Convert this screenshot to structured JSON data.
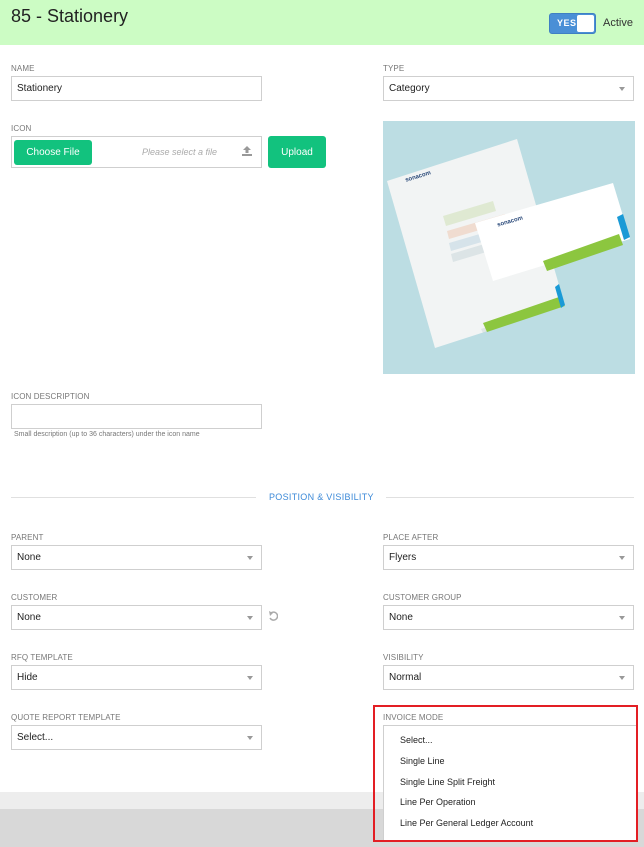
{
  "header": {
    "title": "85 - Stationery",
    "toggle_label": "YES",
    "status_label": "Active"
  },
  "form": {
    "name": {
      "label": "NAME",
      "value": "Stationery"
    },
    "type": {
      "label": "TYPE",
      "value": "Category"
    },
    "icon": {
      "label": "ICON",
      "choose_file": "Choose File",
      "placeholder": "Please select a file",
      "upload": "Upload"
    },
    "icon_description": {
      "label": "ICON DESCRIPTION",
      "value": "",
      "hint": "Small description (up to 36 characters) under the icon name"
    },
    "section_title": "POSITION & VISIBILITY",
    "parent": {
      "label": "PARENT",
      "value": "None"
    },
    "place_after": {
      "label": "PLACE AFTER",
      "value": "Flyers"
    },
    "customer": {
      "label": "CUSTOMER",
      "value": "None"
    },
    "customer_group": {
      "label": "CUSTOMER GROUP",
      "value": "None"
    },
    "rfq_template": {
      "label": "RFQ TEMPLATE",
      "value": "Hide"
    },
    "visibility": {
      "label": "VISIBILITY",
      "value": "Normal"
    },
    "quote_report_template": {
      "label": "QUOTE REPORT TEMPLATE",
      "value": "Select..."
    },
    "invoice_mode": {
      "label": "INVOICE MODE",
      "options": [
        "Select...",
        "Single Line",
        "Single Line Split Freight",
        "Line Per Operation",
        "Line Per General Ledger Account"
      ]
    }
  },
  "image": {
    "brand_text": "sonacom"
  },
  "colors": {
    "header_bg": "#ccfcc4",
    "accent_green": "#12c27e",
    "toggle_blue": "#4a8fd6",
    "section_blue": "#3d8ad8",
    "highlight_red": "#e31e24"
  }
}
